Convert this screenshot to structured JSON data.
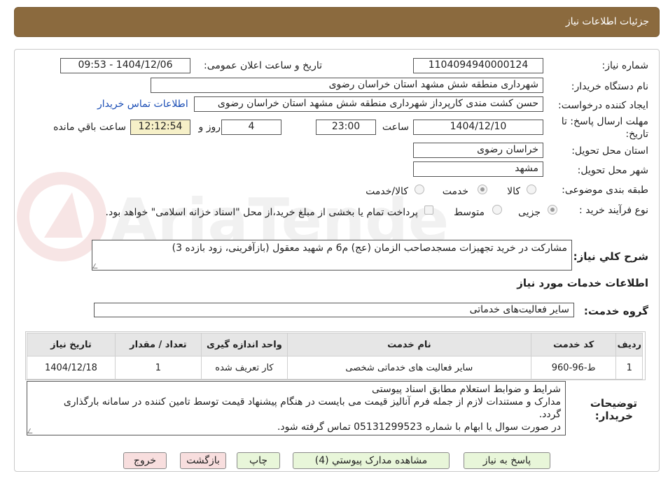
{
  "title": "جزئیات اطلاعات نیاز",
  "labels": {
    "need_number": "شماره نیاز:",
    "announce_datetime": "تاریخ و ساعت اعلان عمومی:",
    "buyer_org": "نام دستگاه خریدار:",
    "requester": "ایجاد کننده درخواست:",
    "deadline_line1": "مهلت ارسال پاسخ: تا",
    "deadline_line2": "تاریخ:",
    "hour": "ساعت",
    "days_and": "روز و",
    "time_left": "ساعت باقي مانده",
    "province": "استان محل تحویل:",
    "city": "شهر محل تحویل:",
    "category": "طبقه بندی موضوعی:",
    "process_type": "نوع فرآیند خرید :",
    "general_desc": "شرح كلي نیاز:",
    "service_info": "اطلاعات خدمات مورد نیاز",
    "service_group": "گروه خدمت:",
    "buyer_notes_1": "توضیحات",
    "buyer_notes_2": "خریدار:"
  },
  "values": {
    "need_number": "1104094940000124",
    "announce_datetime": "1404/12/06 - 09:53",
    "buyer_org": "شهرداری منطقه شش مشهد استان خراسان رضوی",
    "requester": "حسن کشت مندی کارپرداز شهرداری منطقه شش مشهد استان خراسان رضوی",
    "contact_link": "اطلاعات تماس خریدار",
    "deadline_date": "1404/12/10",
    "deadline_hour": "23:00",
    "days": "4",
    "remaining": "12:12:54",
    "province": "خراسان رضوی",
    "city": "مشهد",
    "general_desc": "مشارکت در خرید تجهیزات مسجدصاحب الزمان (عج) م6 م شهید معقول (بازآفرینی، زود بازده 3)",
    "service_group": "سایر فعالیت‌های خدماتی"
  },
  "category_options": [
    {
      "label": "کالا",
      "selected": false
    },
    {
      "label": "خدمت",
      "selected": true
    },
    {
      "label": "کالا/خدمت",
      "selected": false
    }
  ],
  "process_options": [
    {
      "label": "جزیی",
      "selected": true
    },
    {
      "label": "متوسط",
      "selected": false
    }
  ],
  "payment_note": "پرداخت تمام یا بخشی از مبلغ خرید،از محل \"اسناد خزانه اسلامی\" خواهد بود.",
  "table": {
    "headers": [
      "ردیف",
      "کد خدمت",
      "نام خدمت",
      "واحد اندازه گیری",
      "تعداد / مقدار",
      "تاریخ نیاز"
    ],
    "rows": [
      [
        "1",
        "ط-96-960",
        "سایر فعالیت های خدماتی شخصی",
        "کار تعریف شده",
        "1",
        "1404/12/18"
      ]
    ]
  },
  "notes": [
    "شرایط و ضوابط استعلام مطابق اسناد پیوستی",
    "مدارک و مستندات لازم از جمله فرم آنالیز قیمت می بایست در هنگام پیشنهاد قیمت توسط تامین کننده در سامانه بارگذاری",
    "گردد.",
    "در صورت سوال یا ابهام با شماره 05131299523 تماس گرفته شود."
  ],
  "buttons": {
    "reply": "پاسخ به نیاز",
    "view_docs": "مشاهده مدارک پیوستي (4)",
    "print": "چاپ",
    "back": "بازگشت",
    "exit": "خروج"
  },
  "watermark_text": "AriaTender.neT",
  "colors": {
    "header": "#8B6A3E",
    "green_button": "#e8f6d9",
    "red_button": "#f8dede",
    "link": "#1a4db5"
  }
}
